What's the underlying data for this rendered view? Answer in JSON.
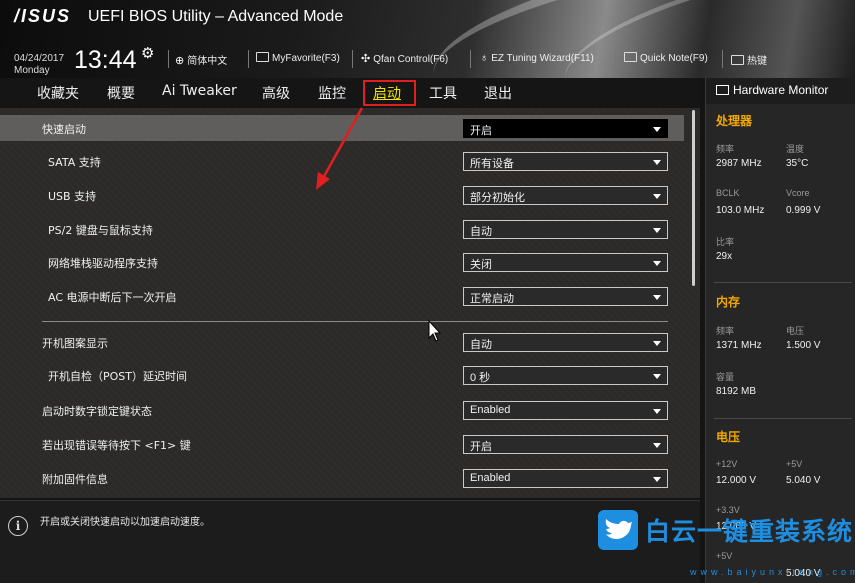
{
  "header": {
    "brand": "/ISUS",
    "title": "UEFI BIOS Utility – Advanced Mode",
    "date": "04/24/2017",
    "weekday": "Monday",
    "time": "13:44",
    "tools": [
      {
        "label": "简体中文",
        "icon": "globe-icon"
      },
      {
        "label": "MyFavorite(F3)",
        "icon": "favorite-icon"
      },
      {
        "label": "Qfan Control(F6)",
        "icon": "fan-icon"
      },
      {
        "label": "EZ Tuning Wizard(F11)",
        "icon": "bulb-icon"
      },
      {
        "label": "Quick Note(F9)",
        "icon": "note-icon"
      },
      {
        "label": "热键",
        "icon": "hotkey-icon"
      }
    ]
  },
  "nav": {
    "tabs": [
      {
        "label": "收藏夹"
      },
      {
        "label": "概要"
      },
      {
        "label": "Ai Tweaker"
      },
      {
        "label": "高级"
      },
      {
        "label": "监控"
      },
      {
        "label": "启动",
        "active": true
      },
      {
        "label": "工具"
      },
      {
        "label": "退出"
      }
    ]
  },
  "settings": [
    {
      "label": "快速启动",
      "value": "开启"
    },
    {
      "label": "SATA 支持",
      "value": "所有设备"
    },
    {
      "label": "USB 支持",
      "value": "部分初始化"
    },
    {
      "label": "PS/2 键盘与鼠标支持",
      "value": "自动"
    },
    {
      "label": "网络堆栈驱动程序支持",
      "value": "关闭"
    },
    {
      "label": "AC 电源中断后下一次开启",
      "value": "正常启动"
    },
    {
      "label": "开机图案显示",
      "value": "自动"
    },
    {
      "label": "开机自检（POST）延迟时间",
      "value": "0 秒"
    },
    {
      "label": "启动时数字锁定键状态",
      "value": "Enabled"
    },
    {
      "label": "若出现错误等待按下 <F1> 键",
      "value": "开启"
    },
    {
      "label": "附加固件信息",
      "value": "Enabled"
    }
  ],
  "help": {
    "text": "开启或关闭快速启动以加速启动速度。"
  },
  "monitor": {
    "title": "Hardware Monitor",
    "cpu": {
      "title": "处理器",
      "freq_label": "频率",
      "freq": "2987 MHz",
      "temp_label": "温度",
      "temp": "35°C",
      "bclk_label": "BCLK",
      "bclk": "103.0 MHz",
      "vcore_label": "Vcore",
      "vcore": "0.999 V",
      "ratio_label": "比率",
      "ratio": "29x"
    },
    "memory": {
      "title": "内存",
      "freq_label": "频率",
      "freq": "1371 MHz",
      "volt_label": "电压",
      "volt": "1.500 V",
      "cap_label": "容量",
      "cap": "8192 MB"
    },
    "voltage": {
      "title": "电压",
      "v12_label": "+12V",
      "v12": "12.000 V",
      "v5_label": "+5V",
      "v5": "5.040 V",
      "v33_label": "+3.3V",
      "v33": "12.000 V",
      "v5sb_label": "+5V",
      "v5sb": "5.040 V"
    }
  },
  "watermark": {
    "text": "白云一键重装系统",
    "sub": "www.baiyunxitong.com"
  },
  "colors": {
    "active_tab": "#f2e400",
    "section_title": "#f2a800",
    "annotation": "#e02020",
    "watermark": "#1e8ee0"
  }
}
